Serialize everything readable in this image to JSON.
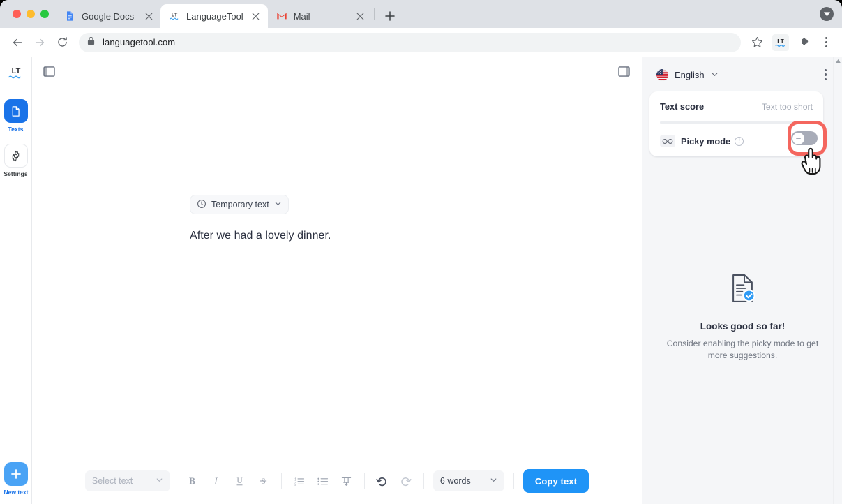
{
  "browser": {
    "tabs": [
      {
        "title": "Google Docs",
        "icon": "google-docs-icon",
        "active": false
      },
      {
        "title": "LanguageTool",
        "icon": "languagetool-icon",
        "active": true
      },
      {
        "title": "Mail",
        "icon": "gmail-icon",
        "active": false
      }
    ],
    "new_tab_label": "+",
    "url": "languagetool.com",
    "lock_icon": "lock-icon",
    "back_icon": "back-arrow-icon",
    "forward_icon": "forward-arrow-icon",
    "reload_icon": "reload-icon",
    "bookmark_icon": "star-icon",
    "extension_icon": "languagetool-extension-icon",
    "puzzle_icon": "extensions-puzzle-icon",
    "menu_icon": "browser-menu-icon",
    "window_control_icon": "window-collapse-icon"
  },
  "rail": {
    "logo": "languagetool-logo",
    "items": [
      {
        "label": "Texts",
        "icon": "document-icon",
        "active": true
      },
      {
        "label": "Settings",
        "icon": "gear-icon",
        "active": false
      }
    ],
    "new_text": {
      "label": "New text",
      "icon": "plus-icon"
    }
  },
  "editor": {
    "left_panel_toggle_icon": "left-sidebar-toggle-icon",
    "right_panel_toggle_icon": "right-sidebar-toggle-icon",
    "doc_chip": {
      "label": "Temporary text",
      "icon": "clock-icon",
      "chevron": "chevron-down-icon"
    },
    "content": "After we had a lovely dinner."
  },
  "toolbar": {
    "select_text": {
      "value": "Select text",
      "chevron": "chevron-down-icon"
    },
    "format_buttons": [
      {
        "name": "bold-button",
        "glyph": "B"
      },
      {
        "name": "italic-button",
        "glyph": "I"
      },
      {
        "name": "underline-button",
        "glyph": "U"
      },
      {
        "name": "strikethrough-button",
        "glyph": "S"
      }
    ],
    "list_buttons": [
      {
        "name": "numbered-list-button"
      },
      {
        "name": "bulleted-list-button"
      },
      {
        "name": "clear-formatting-button"
      }
    ],
    "history_buttons": [
      {
        "name": "undo-button"
      },
      {
        "name": "redo-button"
      }
    ],
    "word_count": {
      "value": "6 words",
      "chevron": "chevron-down-icon"
    },
    "copy_text_label": "Copy text"
  },
  "right_panel": {
    "language": {
      "label": "English",
      "flag": "us-flag-icon",
      "chevron": "chevron-down-icon"
    },
    "menu_icon": "panel-menu-icon",
    "score_card": {
      "label": "Text score",
      "status": "Text too short",
      "progress": 0
    },
    "picky_mode": {
      "label": "Picky mode",
      "icon": "glasses-icon",
      "info_icon": "info-icon",
      "enabled": false,
      "highlighted": true
    },
    "empty_state": {
      "icon": "document-check-icon",
      "title": "Looks good so far!",
      "subtitle": "Consider enabling the picky mode to get more suggestions."
    }
  },
  "colors": {
    "accent_blue": "#1a73e8",
    "copy_button": "#1f94f7",
    "highlight_red": "#f4665e",
    "panel_bg": "#f5f6f8",
    "muted_text": "#a2a8b4"
  }
}
